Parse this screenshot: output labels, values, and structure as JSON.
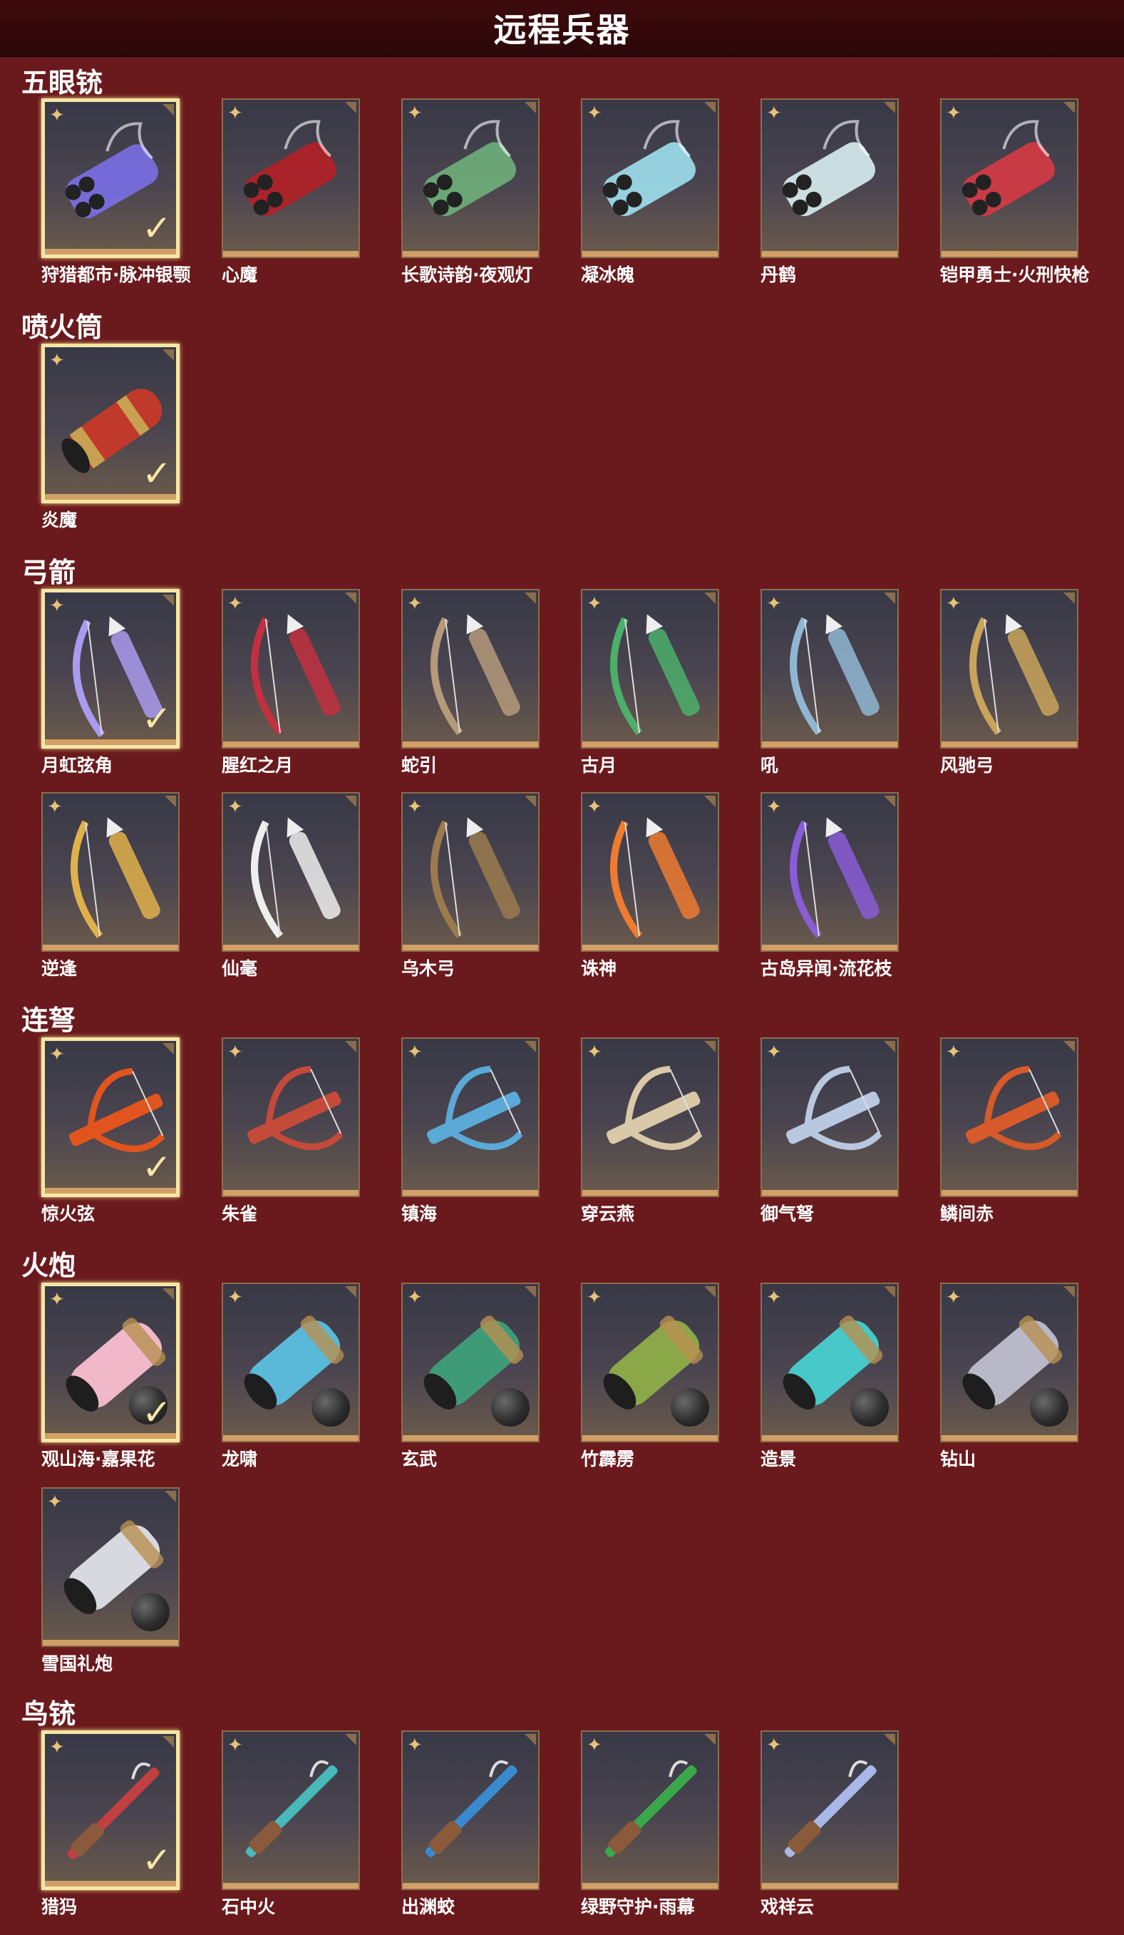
{
  "page": {
    "title": "远程兵器",
    "colors": {
      "background": "#6a1a1d",
      "header": "#3d0b0e",
      "selected_border": "#f6e7a6",
      "frame_base": "#d2a066"
    }
  },
  "sections": [
    {
      "title": "五眼铳",
      "items": [
        {
          "name": "狩猎都市·脉冲银颚",
          "selected": true,
          "color": "#7a6fe6",
          "icon": "multi-barrel-gun-icon"
        },
        {
          "name": "心魔",
          "selected": false,
          "color": "#b42026",
          "icon": "multi-barrel-gun-icon"
        },
        {
          "name": "长歌诗韵·夜观灯",
          "selected": false,
          "color": "#6fb07a",
          "icon": "multi-barrel-gun-icon"
        },
        {
          "name": "凝冰魄",
          "selected": false,
          "color": "#9fe0ee",
          "icon": "multi-barrel-gun-icon"
        },
        {
          "name": "丹鹤",
          "selected": false,
          "color": "#d8eef2",
          "icon": "multi-barrel-gun-icon"
        },
        {
          "name": "铠甲勇士·火刑快枪",
          "selected": false,
          "color": "#d63a44",
          "icon": "multi-barrel-gun-icon"
        }
      ]
    },
    {
      "title": "喷火筒",
      "items": [
        {
          "name": "炎魔",
          "selected": true,
          "color": "#c0392b",
          "icon": "flamethrower-icon"
        }
      ]
    },
    {
      "title": "弓箭",
      "items": [
        {
          "name": "月虹弦角",
          "selected": true,
          "color": "#a99bef",
          "icon": "bow-icon"
        },
        {
          "name": "腥红之月",
          "selected": false,
          "color": "#c23040",
          "icon": "bow-icon"
        },
        {
          "name": "蛇引",
          "selected": false,
          "color": "#b49a7a",
          "icon": "bow-icon"
        },
        {
          "name": "古月",
          "selected": false,
          "color": "#4caf6a",
          "icon": "bow-icon"
        },
        {
          "name": "吼",
          "selected": false,
          "color": "#8fb7d4",
          "icon": "bow-icon"
        },
        {
          "name": "风驰弓",
          "selected": false,
          "color": "#c9a45a",
          "icon": "bow-icon"
        },
        {
          "name": "逆逢",
          "selected": false,
          "color": "#e0b04a",
          "icon": "bow-icon"
        },
        {
          "name": "仙毫",
          "selected": false,
          "color": "#eeeeee",
          "icon": "bow-icon"
        },
        {
          "name": "乌木弓",
          "selected": false,
          "color": "#9b7a4e",
          "icon": "bow-icon"
        },
        {
          "name": "诛神",
          "selected": false,
          "color": "#ef7a30",
          "icon": "bow-icon"
        },
        {
          "name": "古岛异闻·流花枝",
          "selected": false,
          "color": "#8a5cd6",
          "icon": "bow-icon"
        }
      ]
    },
    {
      "title": "连弩",
      "items": [
        {
          "name": "惊火弦",
          "selected": true,
          "color": "#e2541e",
          "icon": "crossbow-icon"
        },
        {
          "name": "朱雀",
          "selected": false,
          "color": "#c44a3a",
          "icon": "crossbow-icon"
        },
        {
          "name": "镇海",
          "selected": false,
          "color": "#5aa9d6",
          "icon": "crossbow-icon"
        },
        {
          "name": "穿云燕",
          "selected": false,
          "color": "#d9c9a8",
          "icon": "crossbow-icon"
        },
        {
          "name": "御气弩",
          "selected": false,
          "color": "#b8c8e0",
          "icon": "crossbow-icon"
        },
        {
          "name": "鳞间赤",
          "selected": false,
          "color": "#d65a2a",
          "icon": "crossbow-icon"
        }
      ]
    },
    {
      "title": "火炮",
      "items": [
        {
          "name": "观山海·嘉果花",
          "selected": true,
          "color": "#f0b8c8",
          "icon": "cannon-icon"
        },
        {
          "name": "龙啸",
          "selected": false,
          "color": "#5ab8d8",
          "icon": "cannon-icon"
        },
        {
          "name": "玄武",
          "selected": false,
          "color": "#3f9a78",
          "icon": "cannon-icon"
        },
        {
          "name": "竹霹雳",
          "selected": false,
          "color": "#8aa848",
          "icon": "cannon-icon"
        },
        {
          "name": "造景",
          "selected": false,
          "color": "#48c8c8",
          "icon": "cannon-icon"
        },
        {
          "name": "钻山",
          "selected": false,
          "color": "#b8b8c8",
          "icon": "cannon-icon"
        },
        {
          "name": "雪国礼炮",
          "selected": false,
          "color": "#d8d8e0",
          "icon": "cannon-icon"
        }
      ]
    },
    {
      "title": "鸟铳",
      "items": [
        {
          "name": "猎犸",
          "selected": true,
          "color": "#c04040",
          "icon": "musket-icon"
        },
        {
          "name": "石中火",
          "selected": false,
          "color": "#48b8b8",
          "icon": "musket-icon"
        },
        {
          "name": "出渊蛟",
          "selected": false,
          "color": "#3a8ad0",
          "icon": "musket-icon"
        },
        {
          "name": "绿野守护·雨幕",
          "selected": false,
          "color": "#3aa84a",
          "icon": "musket-icon"
        },
        {
          "name": "戏祥云",
          "selected": false,
          "color": "#a8b8e8",
          "icon": "musket-icon"
        }
      ]
    }
  ]
}
